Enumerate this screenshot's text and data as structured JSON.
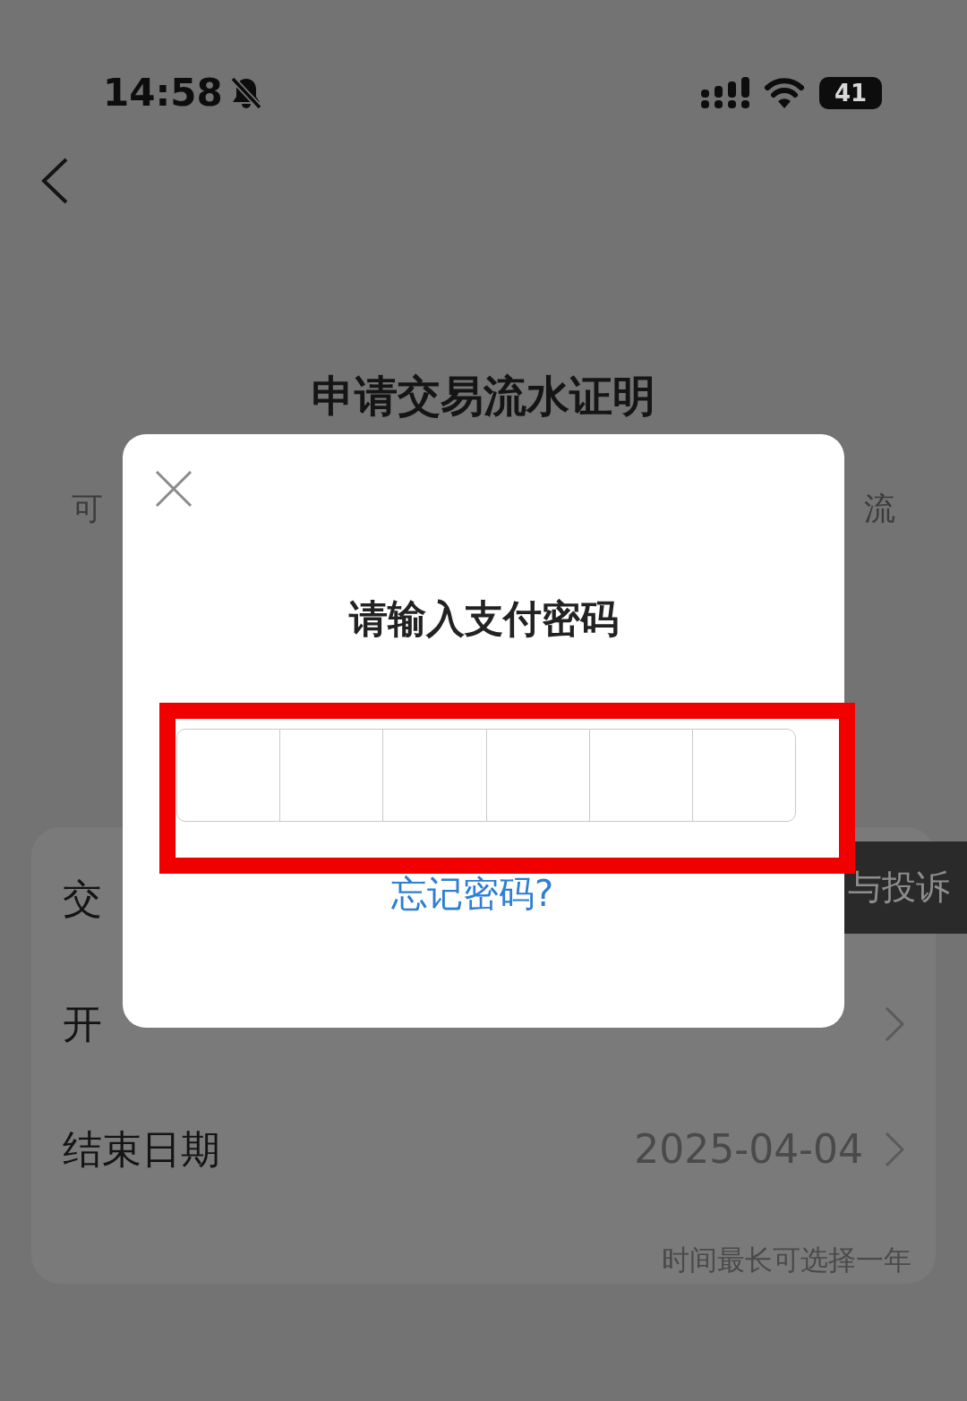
{
  "status_bar": {
    "time": "14:58",
    "silent": true,
    "battery_text": "41"
  },
  "page": {
    "title": "申请交易流水证明",
    "description_left": "可",
    "description_right": "流"
  },
  "form": {
    "rows": [
      {
        "label": "交"
      },
      {
        "label": "开",
        "chevron": true
      },
      {
        "label": "结束日期",
        "value": "2025-04-04",
        "chevron": true
      }
    ],
    "note": "时间最长可选择一年"
  },
  "tooltip": {
    "text": "与投诉"
  },
  "dialog": {
    "title": "请输入支付密码",
    "digits": [
      {
        "filled": false
      },
      {
        "filled": false
      },
      {
        "filled": false
      },
      {
        "filled": false
      },
      {
        "filled": false
      },
      {
        "filled": false
      }
    ],
    "forgot_link": "忘记密码?",
    "highlighted": true
  }
}
